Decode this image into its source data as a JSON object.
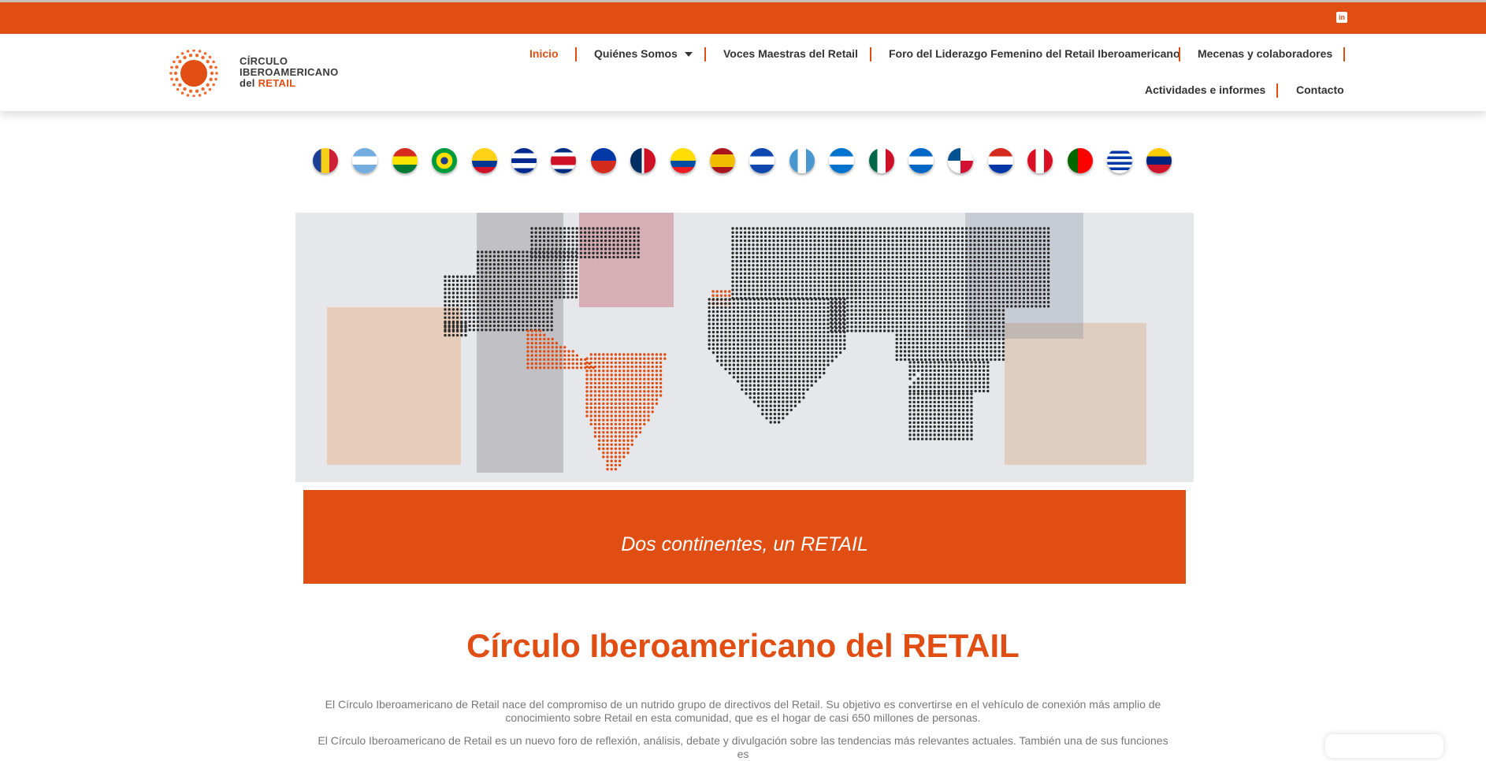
{
  "social": {
    "icon": "linkedin-icon",
    "glyph": "in"
  },
  "logo": {
    "line1": "CÍRCULO",
    "line2": "IBEROAMERICANO",
    "line3_prefix": "del ",
    "line3_accent": "RETAIL"
  },
  "nav": {
    "items": [
      "Inicio",
      "Quiénes Somos",
      "Voces Maestras del Retail",
      "Foro del Liderazgo Femenino del Retail Iberoamericano",
      "Mecenas y colaboradores",
      "Actividades e informes",
      "Contacto"
    ],
    "active": "Inicio"
  },
  "flags": [
    "Andorra",
    "Argentina",
    "Bolivia",
    "Brasil",
    "Colombia",
    "Cuba",
    "Costa Rica",
    "Chile",
    "República Dominicana",
    "Ecuador",
    "España",
    "El Salvador",
    "Guatemala",
    "Honduras",
    "México",
    "Nicaragua",
    "Panamá",
    "Paraguay",
    "Perú",
    "Portugal",
    "Uruguay",
    "Venezuela"
  ],
  "banner": {
    "text": "Dos continentes, un RETAIL"
  },
  "main": {
    "title": "Círculo Iberoamericano del RETAIL",
    "para1_line1": "El Círculo Iberoamericano de Retail nace del compromiso de un nutrido grupo de directivos del Retail. Su objetivo es convertirse en el vehículo de conexión más amplio de",
    "para1_line2": "conocimiento sobre Retail en esta comunidad, que es el hogar de casi 650 millones de personas.",
    "para2_line1": "El Círculo Iberoamericano de Retail es un nuevo foro de reflexión, análisis, debate y divulgación sobre las tendencias más relevantes actuales. También una de sus funciones es"
  },
  "colors": {
    "brand": "#e04e14",
    "text": "#333333",
    "muted": "#777777"
  }
}
